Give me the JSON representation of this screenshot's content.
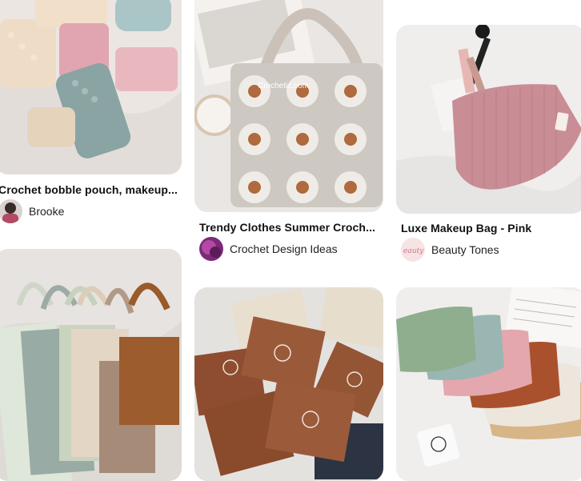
{
  "pins": [
    {
      "title": "Crochet bobble pouch, makeup...",
      "author": "Brooke",
      "avatar_icon": "person-avatar"
    },
    {
      "title": "Trendy Clothes Summer Croch...",
      "author": "Crochet Design Ideas",
      "avatar_icon": "purple-yarn-avatar",
      "watermark": "Crochetic.com"
    },
    {
      "title": "Luxe Makeup Bag - Pink",
      "author": "Beauty Tones",
      "avatar_icon": "beauty-script-avatar",
      "avatar_text": "eauty"
    },
    {
      "image_icon": "tote-bags-image"
    },
    {
      "image_icon": "brown-pouches-image"
    },
    {
      "image_icon": "corduroy-pouches-image"
    }
  ],
  "colors": {
    "card_bg": "#efefef",
    "text": "#111111",
    "pink_bag": "#c98d96",
    "brown": "#9a5a3a",
    "sage": "#8fae8e"
  }
}
